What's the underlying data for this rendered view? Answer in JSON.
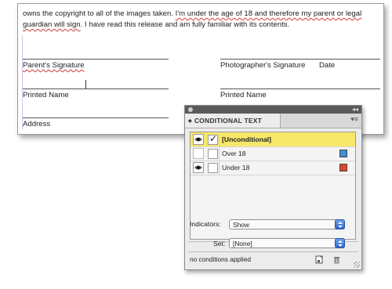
{
  "document": {
    "paragraph_plain_1": "owns the copyright to all of the images taken. ",
    "paragraph_conditional": "I'm under the age of 18 and therefore my parent or legal guardian will sign",
    "paragraph_plain_2": ". I have read this release and am fully familiar with its contents.",
    "parent_signature_label": "Parent's Signature",
    "photographer_signature_label": "Photographer's Signature",
    "date_label": "Date",
    "printed_name_left": "Printed Name",
    "printed_name_right": "Printed Name",
    "address_label": "Address"
  },
  "panel": {
    "title": "CONDITIONAL TEXT",
    "conditions": [
      {
        "name": "[Unconditional]",
        "visible": true,
        "checked": true,
        "selected": true,
        "color": ""
      },
      {
        "name": "Over 18",
        "visible": false,
        "checked": false,
        "selected": false,
        "color": "#3f8fd6"
      },
      {
        "name": "Under 18",
        "visible": true,
        "checked": false,
        "selected": false,
        "color": "#e2432a"
      }
    ],
    "indicators_label": "Indicators:",
    "indicators_value": "Show",
    "set_label": "Set:",
    "set_value": "[None]",
    "status_text": "no conditions applied"
  },
  "icons": {
    "eye": "eye-icon",
    "new_condition": "new-condition-icon",
    "delete": "trash-icon",
    "menu": "panel-menu-icon"
  }
}
